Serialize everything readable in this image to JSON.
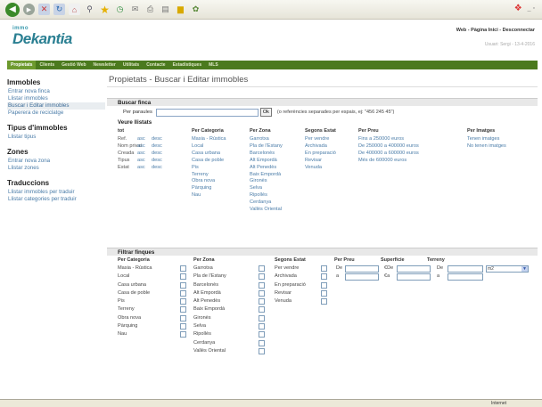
{
  "header": {
    "logo_top": "immo",
    "logo_main": "Dekantia",
    "links": "Web - Pàgina Inici - Desconnectar",
    "user_line": "Usuari: Sergi - 13-4-2016"
  },
  "nav": {
    "items": [
      "Propietats",
      "Clients",
      "Gestió Web",
      "Newsletter",
      "Utilitats",
      "Contacte",
      "Estadístiques",
      "MLS"
    ]
  },
  "sidebar": {
    "sections": [
      {
        "title": "Immobles",
        "links": [
          "Entrar nova finca",
          "Llistar immobles",
          "Buscar i Editar immobles",
          "Paperera de reciclatge"
        ]
      },
      {
        "title": "Tipus d'immobles",
        "links": [
          "Llistar tipus"
        ]
      },
      {
        "title": "Zones",
        "links": [
          "Entrar nova zona",
          "Llistar zones"
        ]
      },
      {
        "title": "Traduccions",
        "links": [
          "Llistar immobles per traduir",
          "Llistar categories per traduir"
        ]
      }
    ]
  },
  "main": {
    "title": "Propietats - Buscar i Editar immobles",
    "search": {
      "heading": "Buscar finca",
      "label": "Per paraules",
      "value": "",
      "button": "Ok",
      "hint": "(o referències separades per espais, ej: \"456 245 45\")"
    },
    "lists": {
      "heading": "Veure llistats",
      "tot": {
        "header": "tot",
        "items": [
          "Ref.",
          "Nom privat",
          "Creada",
          "Tipus",
          "Estat"
        ],
        "asc": "asc",
        "desc": "desc"
      },
      "categoria": {
        "header": "Per Categoria",
        "items": [
          "Masia - Rústica",
          "Local",
          "Casa urbana",
          "Casa de poble",
          "Pis",
          "Terreny",
          "Obra nova",
          "Pàrquing",
          "Nau"
        ]
      },
      "zona": {
        "header": "Per Zona",
        "items": [
          "Garrotxa",
          "Pla de l'Estany",
          "Barcelonès",
          "Alt Empordà",
          "Alt Penedès",
          "Baix Empordà",
          "Gironès",
          "Selva",
          "Ripollès",
          "Cerdanya",
          "Vallès Oriental"
        ]
      },
      "estat": {
        "header": "Segons Estat",
        "items": [
          "Per vendre",
          "Archivada",
          "En preparació",
          "Revisar",
          "Venuda"
        ]
      },
      "preu": {
        "header": "Per Preu",
        "items": [
          "Fins a 250000 euros",
          "De 250000 a 400000 euros",
          "De 400000 a 600000 euros",
          "Més de 600000 euros"
        ]
      },
      "imatges": {
        "header": "Per Imatges",
        "items": [
          "Tenen imatges",
          "No tenen imatges"
        ]
      }
    },
    "filters": {
      "heading": "Filtrar finques",
      "categoria": {
        "header": "Per Categoria",
        "items": [
          "Masia - Rústica",
          "Local",
          "Casa urbana",
          "Casa de poble",
          "Pis",
          "Terreny",
          "Obra nova",
          "Pàrquing",
          "Nau"
        ]
      },
      "zona": {
        "header": "Per Zona",
        "items": [
          "Garrotxa",
          "Pla de l'Estany",
          "Barcelonès",
          "Alt Empordà",
          "Alt Penedès",
          "Baix Empordà",
          "Gironès",
          "Selva",
          "Ripollès",
          "Cerdanya",
          "Vallès Oriental"
        ]
      },
      "estat": {
        "header": "Segons Estat",
        "items": [
          "Per vendre",
          "Archivada",
          "En preparació",
          "Revisar",
          "Venuda"
        ]
      },
      "preu": {
        "header": "Per Preu",
        "de": "De",
        "a": "a"
      },
      "superficie": {
        "header": "Superficie",
        "de": "€De",
        "a": "€a"
      },
      "terreny": {
        "header": "Terreny",
        "de": "De",
        "a": "a",
        "unit": "m2"
      }
    }
  },
  "status": {
    "zone": "Internet"
  }
}
